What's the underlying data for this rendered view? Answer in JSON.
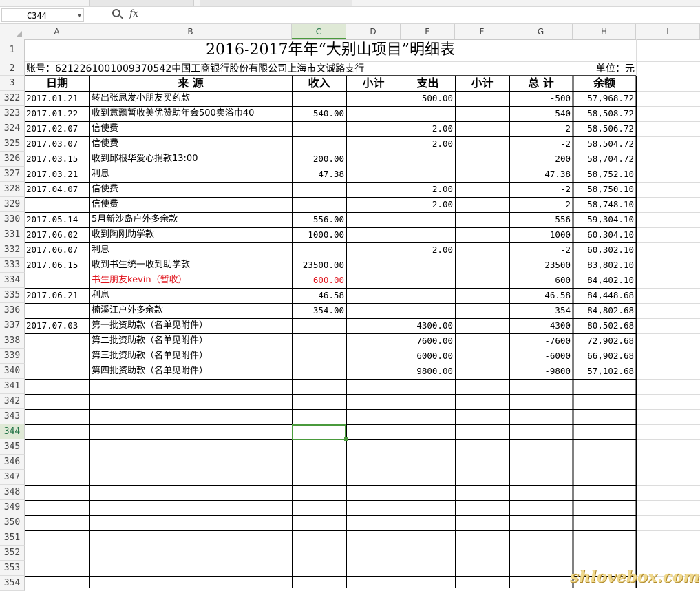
{
  "formula_bar": {
    "cell_ref": "C344",
    "fx": "fx",
    "value": ""
  },
  "columns": [
    "A",
    "B",
    "C",
    "D",
    "E",
    "F",
    "G",
    "H",
    "I"
  ],
  "selected_column": "C",
  "selected_row": "344",
  "sheet": {
    "title": "2016-2017年年“大别山项目”明细表",
    "account": "账号：6212261001009370542中国工商银行股份有限公司上海市文诚路支行",
    "unit": "单位：元",
    "headers": {
      "date": "日期",
      "source": "来 源",
      "income": "收入",
      "subtotal1": "小计",
      "expense": "支出",
      "subtotal2": "小计",
      "total": "总 计",
      "balance": "余额"
    }
  },
  "rows": [
    {
      "row": "322",
      "date": "2017.01.21",
      "source": "转出张思发小朋友买药款",
      "income": "",
      "expense": "500.00",
      "total": "-500",
      "balance": "57,968.72"
    },
    {
      "row": "323",
      "date": "2017.01.22",
      "source": "收到意飘暂收美优赞助年会500卖浴巾40",
      "income": "540.00",
      "expense": "",
      "total": "540",
      "balance": "58,508.72"
    },
    {
      "row": "324",
      "date": "2017.02.07",
      "source": "信使费",
      "income": "",
      "expense": "2.00",
      "total": "-2",
      "balance": "58,506.72"
    },
    {
      "row": "325",
      "date": "2017.03.07",
      "source": "信使费",
      "income": "",
      "expense": "2.00",
      "total": "-2",
      "balance": "58,504.72"
    },
    {
      "row": "326",
      "date": "2017.03.15",
      "source": "收到邱根华爱心捐款13:00",
      "income": "200.00",
      "expense": "",
      "total": "200",
      "balance": "58,704.72"
    },
    {
      "row": "327",
      "date": "2017.03.21",
      "source": "利息",
      "income": "47.38",
      "expense": "",
      "total": "47.38",
      "balance": "58,752.10"
    },
    {
      "row": "328",
      "date": "2017.04.07",
      "source": "信使费",
      "income": "",
      "expense": "2.00",
      "total": "-2",
      "balance": "58,750.10"
    },
    {
      "row": "329",
      "date": "",
      "source": "信使费",
      "income": "",
      "expense": "2.00",
      "total": "-2",
      "balance": "58,748.10"
    },
    {
      "row": "330",
      "date": "2017.05.14",
      "source": "5月新沙岛户外多余款",
      "income": "556.00",
      "expense": "",
      "total": "556",
      "balance": "59,304.10"
    },
    {
      "row": "331",
      "date": "2017.06.02",
      "source": "收到陶刚助学款",
      "income": "1000.00",
      "expense": "",
      "total": "1000",
      "balance": "60,304.10"
    },
    {
      "row": "332",
      "date": "2017.06.07",
      "source": "利息",
      "income": "",
      "expense": "2.00",
      "total": "-2",
      "balance": "60,302.10"
    },
    {
      "row": "333",
      "date": "2017.06.15",
      "source": "收到书生统一收到助学款",
      "income": "23500.00",
      "expense": "",
      "total": "23500",
      "balance": "83,802.10"
    },
    {
      "row": "334",
      "date": "",
      "source": "书生朋友kevin（暂收）",
      "income": "600.00",
      "expense": "",
      "total": "600",
      "balance": "84,402.10",
      "red": true
    },
    {
      "row": "335",
      "date": "2017.06.21",
      "source": "利息",
      "income": "46.58",
      "expense": "",
      "total": "46.58",
      "balance": "84,448.68"
    },
    {
      "row": "336",
      "date": "",
      "source": "楠溪江户外多余款",
      "income": "354.00",
      "expense": "",
      "total": "354",
      "balance": "84,802.68"
    },
    {
      "row": "337",
      "date": "2017.07.03",
      "source": "第一批资助款（名单见附件）",
      "income": "",
      "expense": "4300.00",
      "total": "-4300",
      "balance": "80,502.68"
    },
    {
      "row": "338",
      "date": "",
      "source": "第二批资助款（名单见附件）",
      "income": "",
      "expense": "7600.00",
      "total": "-7600",
      "balance": "72,902.68"
    },
    {
      "row": "339",
      "date": "",
      "source": "第三批资助款（名单见附件）",
      "income": "",
      "expense": "6000.00",
      "total": "-6000",
      "balance": "66,902.68"
    },
    {
      "row": "340",
      "date": "",
      "source": "第四批资助款（名单见附件）",
      "income": "",
      "expense": "9800.00",
      "total": "-9800",
      "balance": "57,102.68"
    },
    {
      "row": "341"
    },
    {
      "row": "342"
    },
    {
      "row": "343"
    },
    {
      "row": "344"
    },
    {
      "row": "345"
    },
    {
      "row": "346"
    },
    {
      "row": "347"
    },
    {
      "row": "348"
    },
    {
      "row": "349"
    },
    {
      "row": "350"
    },
    {
      "row": "351"
    },
    {
      "row": "352"
    },
    {
      "row": "353"
    },
    {
      "row": "354"
    }
  ],
  "top_rows": [
    "1",
    "2",
    "3"
  ],
  "watermark": "shlovebox.com",
  "colors": {
    "accent": "#217346",
    "selection": "#4a9a3c",
    "red_text": "#e0161f"
  }
}
